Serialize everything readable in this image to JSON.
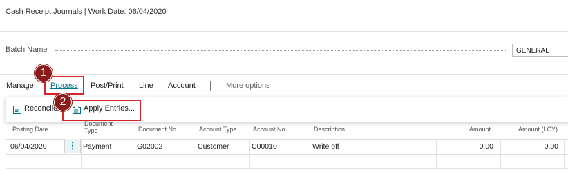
{
  "page": {
    "title": "Cash Receipt Journals | Work Date: 06/04/2020"
  },
  "batch": {
    "label": "Batch Name",
    "value": "GENERAL"
  },
  "menu": {
    "items": [
      "Manage",
      "Process",
      "Post/Print",
      "Line",
      "Account"
    ],
    "active": "Process",
    "more_options": "More options"
  },
  "process_menu": {
    "reconcile": "Reconcile",
    "apply_entries": "Apply Entries..."
  },
  "callouts": [
    "1",
    "2"
  ],
  "table": {
    "columns": [
      "Posting Date",
      "Document Type",
      "Document No.",
      "Account Type",
      "Account No.",
      "Description",
      "Amount",
      "Amount (LCY)"
    ],
    "rows": [
      {
        "posting_date": "06/04/2020",
        "document_type": "Payment",
        "document_no": "G02002",
        "account_type": "Customer",
        "account_no": "C00010",
        "description": "Write off",
        "amount": "0.00",
        "amount_lcy": "0.00"
      }
    ]
  },
  "icons": {
    "row_actions": "vertical-ellipsis-icon",
    "reconcile": "reconcile-icon",
    "apply_entries": "apply-entries-icon"
  },
  "colors": {
    "accent": "#00738a",
    "highlight": "#d8232a",
    "badge": "#8b1a1a"
  }
}
